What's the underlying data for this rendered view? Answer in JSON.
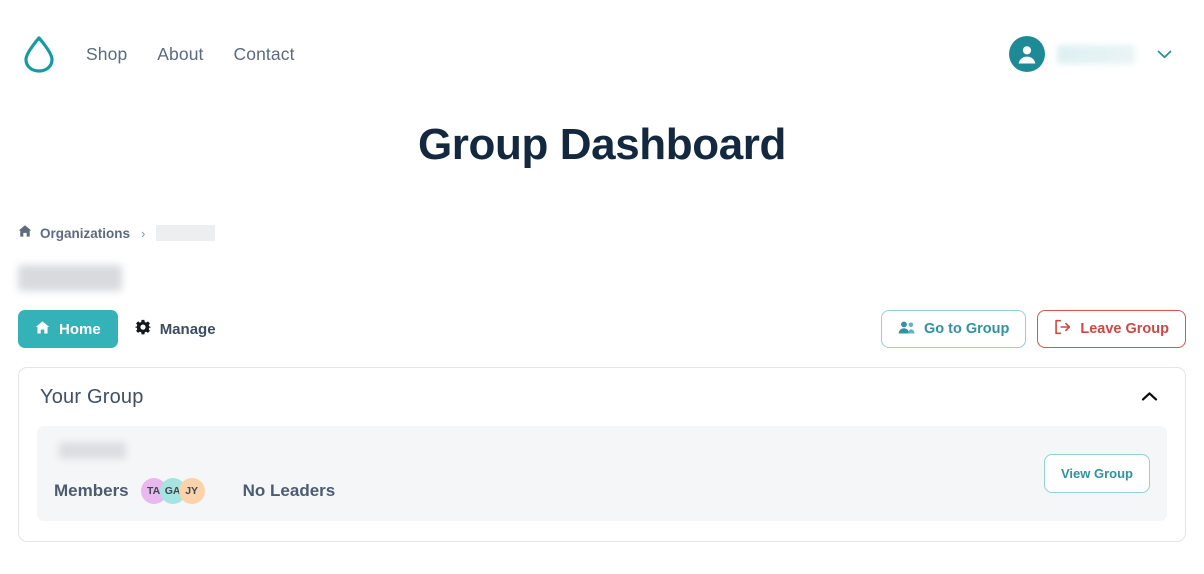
{
  "nav": {
    "logo_icon": "water-drop-logo",
    "links": [
      {
        "label": "Shop"
      },
      {
        "label": "About"
      },
      {
        "label": "Contact"
      }
    ],
    "user": {
      "avatar_icon": "user-avatar-icon",
      "name_redacted": "",
      "chevron_icon": "chevron-down-icon"
    }
  },
  "header": {
    "title": "Group Dashboard"
  },
  "breadcrumb": {
    "home_icon": "home-icon",
    "root_label": "Organizations",
    "separator": "›",
    "current_redacted": ""
  },
  "org_heading_redacted": "",
  "tabs": [
    {
      "label": "Home",
      "icon": "home-icon",
      "active": true
    },
    {
      "label": "Manage",
      "icon": "gear-icon",
      "active": false
    }
  ],
  "actions": {
    "go_to_group": {
      "label": "Go to Group",
      "icon": "users-icon"
    },
    "leave_group": {
      "label": "Leave Group",
      "icon": "sign-out-icon"
    }
  },
  "card": {
    "title": "Your Group",
    "collapse_icon": "chevron-up-icon",
    "group": {
      "name_redacted": "",
      "members_label": "Members",
      "members": [
        {
          "initials": "TA",
          "color": "#e9b8ee"
        },
        {
          "initials": "GA",
          "color": "#a5e4e0"
        },
        {
          "initials": "JY",
          "color": "#fbd3ab"
        }
      ],
      "leaders_label": "No Leaders",
      "view_button_label": "View Group"
    }
  },
  "colors": {
    "teal": "#35b1b8",
    "teal_dark": "#1e8a96",
    "navy": "#14293f",
    "slate": "#5c6b82",
    "red": "#cf4842",
    "row_bg": "#f5f6f7"
  }
}
